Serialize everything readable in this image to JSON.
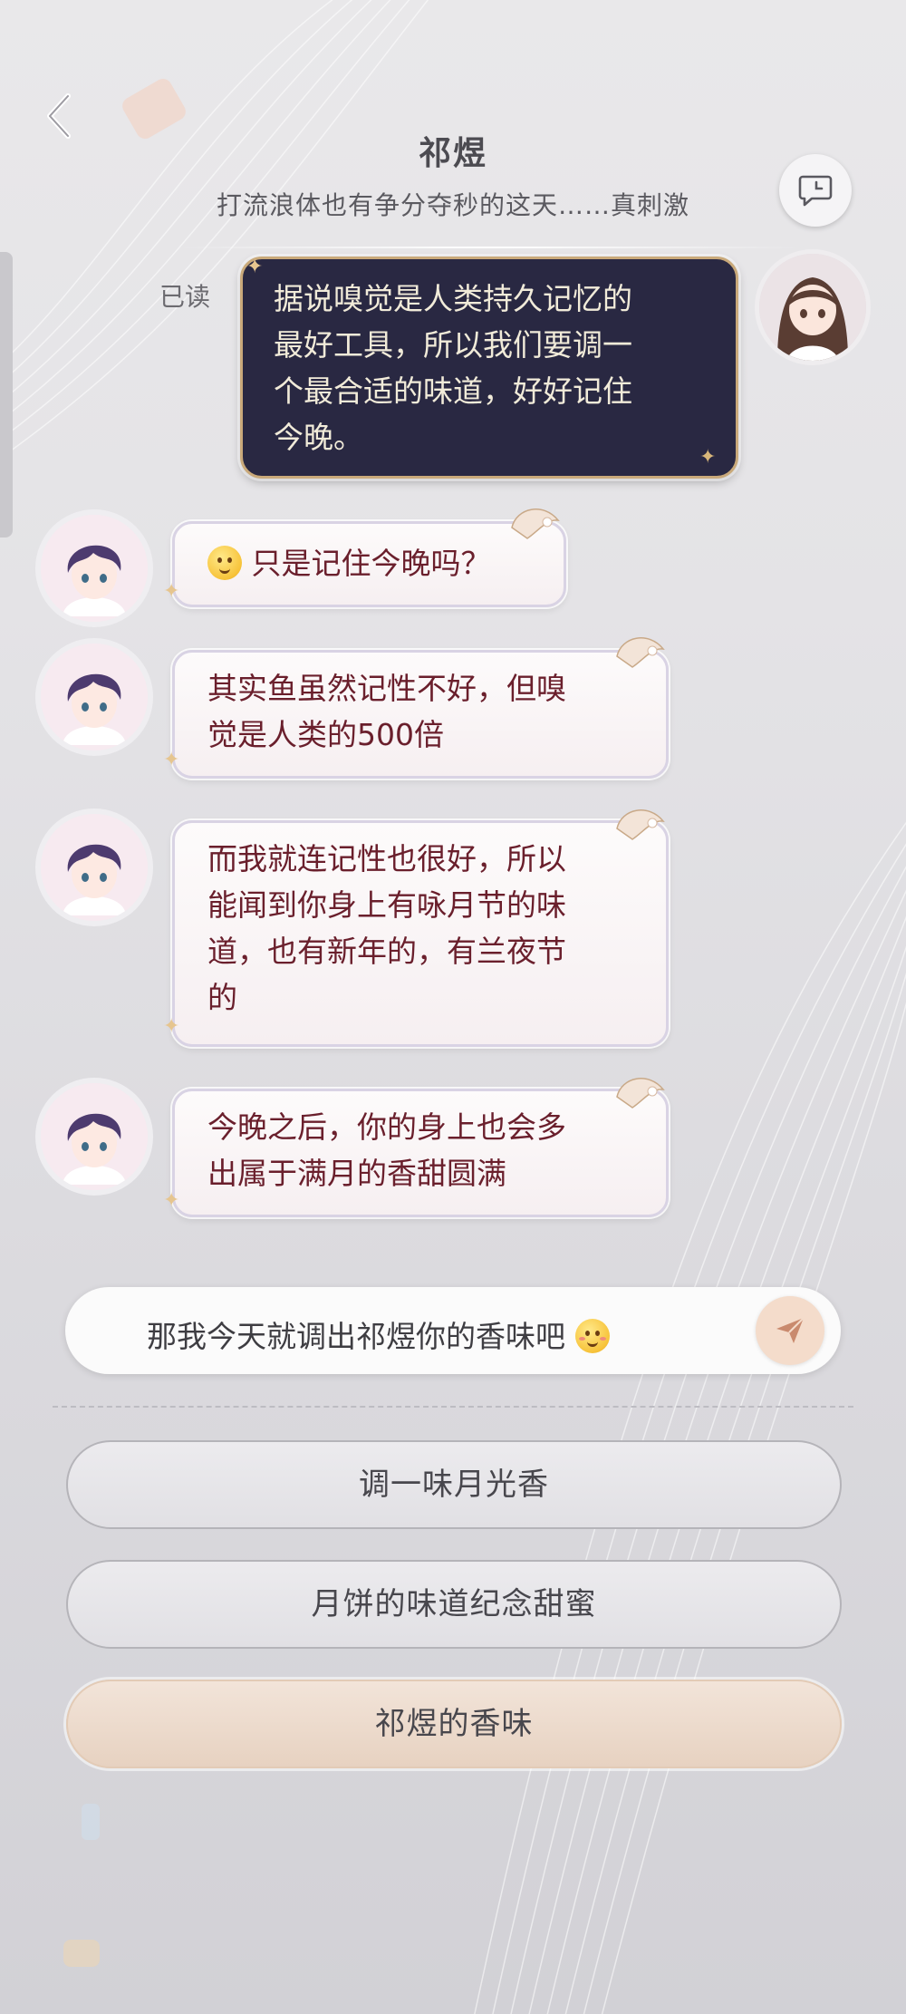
{
  "header": {
    "title": "祁煜",
    "subtitle": "打流浪体也有争分夺秒的这天……真刺激",
    "back_icon": "chevron-left-icon",
    "action_icon": "chat-bubble-icon"
  },
  "read_status": "已读",
  "user_message": {
    "lines": [
      "据说嗅觉是人类持久记忆的",
      "最好工具，所以我们要调一",
      "个最合适的味道，好好记住",
      "今晚。"
    ]
  },
  "character_messages": [
    {
      "text": "只是记住今晚吗？",
      "has_emoji": true
    },
    {
      "lines": [
        "其实鱼虽然记性不好，但嗅",
        "觉是人类的500倍"
      ]
    },
    {
      "lines": [
        "而我就连记性也很好，所以",
        "能闻到你身上有咏月节的味",
        "道，也有新年的，有兰夜节",
        "的"
      ]
    },
    {
      "lines": [
        "今晚之后，你的身上也会多",
        "出属于满月的香甜圆满"
      ]
    }
  ],
  "input": {
    "value": "那我今天就调出祁煜你的香味吧",
    "send_icon": "send-icon"
  },
  "options": [
    {
      "label": "调一味月光香",
      "selected": false
    },
    {
      "label": "月饼的味道纪念甜蜜",
      "selected": false
    },
    {
      "label": "祁煜的香味",
      "selected": true
    }
  ],
  "colors": {
    "user_bubble": "#292842",
    "user_text": "#f1ebd9",
    "char_text": "#6a1f2c",
    "selected_option": "#ecdccf"
  }
}
